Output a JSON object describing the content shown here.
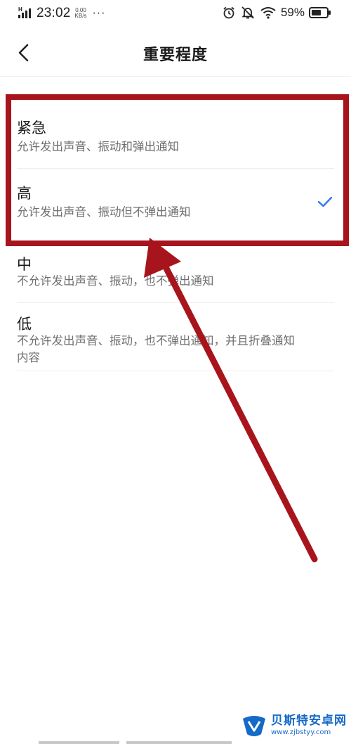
{
  "status_bar": {
    "network_type": "H",
    "time": "23:02",
    "net_speed_value": "0.00",
    "net_speed_unit": "KB/s",
    "overflow": "···",
    "battery_percent": "59%"
  },
  "header": {
    "title": "重要程度",
    "back_icon": "chevron-left-icon"
  },
  "options": [
    {
      "title": "紧急",
      "description": "允许发出声音、振动和弹出通知",
      "selected": false
    },
    {
      "title": "高",
      "description": "允许发出声音、振动但不弹出通知",
      "selected": true
    },
    {
      "title": "中",
      "description": "不允许发出声音、振动，也不弹出通知",
      "selected": false
    },
    {
      "title": "低",
      "description": "不允许发出声音、振动，也不弹出通知，并且折叠通知内容",
      "selected": false
    }
  ],
  "colors": {
    "accent_check": "#2f78f0",
    "annotation_red": "#a8141c",
    "watermark_blue": "#1569c7"
  },
  "watermark": {
    "name": "贝斯特安卓网",
    "url": "www.zjbstyy.com"
  }
}
